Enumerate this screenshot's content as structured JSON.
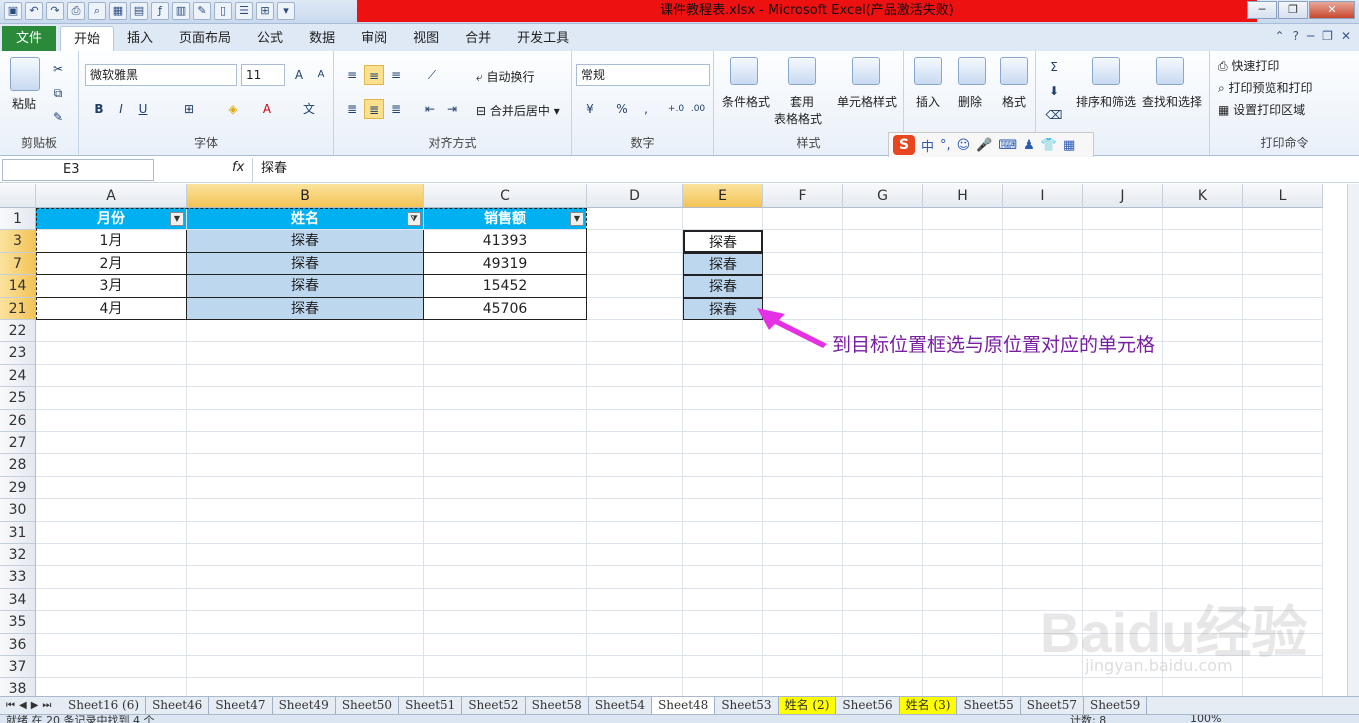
{
  "window": {
    "title": "课件教程表.xlsx - Microsoft Excel(产品激活失败)"
  },
  "ribbon_tabs": [
    "开始",
    "插入",
    "页面布局",
    "公式",
    "数据",
    "审阅",
    "视图",
    "合并",
    "开发工具"
  ],
  "file_tab": "文件",
  "ribbon": {
    "clipboard": {
      "label": "剪贴板",
      "paste": "粘贴"
    },
    "font": {
      "label": "字体",
      "family": "微软雅黑",
      "size": "11"
    },
    "align": {
      "label": "对齐方式",
      "wrap": "自动换行",
      "merge": "合并后居中"
    },
    "number": {
      "label": "数字",
      "format": "常规",
      "percent": "%",
      "comma": ","
    },
    "styles": {
      "label": "样式",
      "cond": "条件格式",
      "table1": "套用",
      "table2": "表格格式",
      "cell": "单元格样式"
    },
    "cells": {
      "insert": "插入",
      "delete": "删除",
      "format": "格式"
    },
    "edit": {
      "label": "编辑",
      "sort": "排序和筛选",
      "find": "查找和选择"
    },
    "print": {
      "label": "打印命令",
      "quick": "快速打印",
      "preview": "打印预览和打印",
      "area": "设置打印区域"
    }
  },
  "ime": {
    "logo": "S",
    "mode": "中"
  },
  "formula_bar": {
    "cell_ref": "E3",
    "fx": "fx",
    "value": "探春"
  },
  "columns": [
    "A",
    "B",
    "C",
    "D",
    "E",
    "F",
    "G",
    "H",
    "I",
    "J",
    "K",
    "L"
  ],
  "rows": [
    "1",
    "3",
    "7",
    "14",
    "21",
    "22",
    "23",
    "24",
    "25",
    "26",
    "27",
    "28",
    "29",
    "30",
    "31",
    "32",
    "33",
    "34",
    "35",
    "36",
    "37",
    "38"
  ],
  "table": {
    "headers": [
      "月份",
      "姓名",
      "销售额"
    ],
    "data": [
      [
        "1月",
        "探春",
        "41393"
      ],
      [
        "2月",
        "探春",
        "49319"
      ],
      [
        "3月",
        "探春",
        "15452"
      ],
      [
        "4月",
        "探春",
        "45706"
      ]
    ]
  },
  "e_col": [
    "探春",
    "探春",
    "探春",
    "探春"
  ],
  "annotation": "到目标位置框选与原位置对应的单元格",
  "sheet_tabs": [
    "Sheet16 (6)",
    "Sheet46",
    "Sheet47",
    "Sheet49",
    "Sheet50",
    "Sheet51",
    "Sheet52",
    "Sheet58",
    "Sheet54",
    "Sheet48",
    "Sheet53",
    "姓名 (2)",
    "Sheet56",
    "姓名 (3)",
    "Sheet55",
    "Sheet57",
    "Sheet59"
  ],
  "status": {
    "left": "就绪    在 20 条记录中找到 4 个",
    "count": "计数: 8",
    "zoom": "100%"
  },
  "watermark": {
    "main": "Baidu经验",
    "sub": "jingyan.baidu.com"
  },
  "colors": {
    "header_blue": "#00b0f0",
    "selection_blue": "#bdd7ee",
    "annot_purple": "#7a1ea1",
    "title_red": "#ee1111"
  }
}
